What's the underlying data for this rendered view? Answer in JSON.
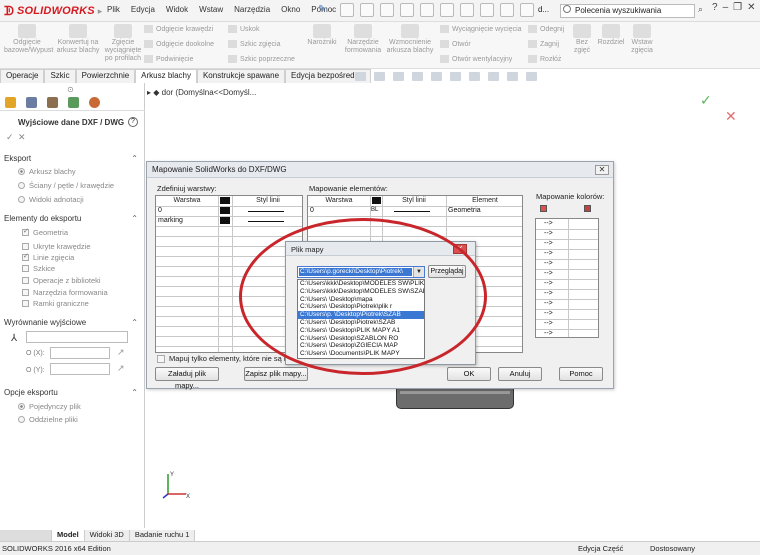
{
  "app": {
    "brand": "SOLIDWORKS",
    "menu": [
      "Plik",
      "Edycja",
      "Widok",
      "Wstaw",
      "Narzędzia",
      "Okno",
      "Pomoc"
    ],
    "doc_name": "d...",
    "search_placeholder": "Polecenia wyszukiwania"
  },
  "ribbon": {
    "big_buttons": [
      "Odgięcie bazowe/Wypust",
      "Konwertuj na arkusz blachy",
      "Zgięcie wyciągnięte po profilach"
    ],
    "small_col1": [
      "Odgięcie krawędzi",
      "Odgięcie dookolne",
      "Podwinięcie"
    ],
    "small_col2": [
      "Uskok",
      "Szkic zgięcia",
      "Szkic poprzeczne"
    ],
    "narozniki": "Narożniki",
    "middle_buttons": [
      "Narzędzie formowania",
      "Wzmocnienie arkusza blachy"
    ],
    "small_col3": [
      "Wyciągnięcie wycięcia",
      "Otwór",
      "Otwór wentylacyjny"
    ],
    "small_col4": [
      "Odegnij",
      "Zagnij",
      "Rozłóż"
    ],
    "right_buttons": [
      "Bez zgięć",
      "Rozdziel",
      "Wstaw zgięcia"
    ]
  },
  "tabs": [
    "Operacje",
    "Szkic",
    "Powierzchnie",
    "Arkusz blachy",
    "Konstrukcje spawane",
    "Edycja bezpośrednia"
  ],
  "active_tab": "Arkusz blachy",
  "tree_item": "dor  (Domyślna<<Domyśl...",
  "panel": {
    "title": "Wyjściowe dane DXF / DWG",
    "export_header": "Eksport",
    "export_options": [
      "Arkusz blachy",
      "Ściany / pętle / krawędzie",
      "Widoki adnotacji"
    ],
    "elements_header": "Elementy do eksportu",
    "elements": [
      {
        "label": "Geometria",
        "checked": true
      },
      {
        "label": "Ukryte krawędzie",
        "checked": false
      },
      {
        "label": "Linie zgięcia",
        "checked": true
      },
      {
        "label": "Szkice",
        "checked": false
      },
      {
        "label": "Operacje z biblioteki",
        "checked": false
      },
      {
        "label": "Narzędzia formowania",
        "checked": false
      },
      {
        "label": "Ramki graniczne",
        "checked": false
      }
    ],
    "align_header": "Wyrównanie wyjściowe",
    "ox": "O (X):",
    "oy": "O (Y):",
    "options_header": "Opcje eksportu",
    "options": [
      "Pojedynczy plik",
      "Oddzielne pliki"
    ]
  },
  "dialog": {
    "title": "Mapowanie SolidWorks do DXF/DWG",
    "define_layers": "Zdefiniuj warstwy:",
    "layers_cols": [
      "Warstwa",
      "Styl linii"
    ],
    "layers_rows": [
      "0",
      "marking"
    ],
    "mapping_label": "Mapowanie elementów:",
    "mapping_cols": [
      "Warstwa",
      "Styl linii",
      "Element"
    ],
    "mapping_row": {
      "layer": "0",
      "style_code": "BL",
      "element": "Geometria"
    },
    "color_mapping": "Mapowanie kolorów:",
    "arrow": "-->",
    "checkbox_label": "Mapuj tylko elementy, które nie są na warstwach SolidWorks",
    "buttons": [
      "Załaduj plik mapy...",
      "Zapisz plik mapy...",
      "OK",
      "Anuluj",
      "Pomoc"
    ]
  },
  "subdialog": {
    "title": "Plik mapy",
    "selected": "C:\\Users\\p.gorecki\\Desktop\\Piotrek\\",
    "browse": "Przeglądaj",
    "list": [
      "C:\\Users\\kkk\\Desktop\\MODELES SW\\PLIK",
      "C:\\Users\\kkk\\Desktop\\MODELES SW\\SZAB",
      "C:\\Users\\               \\Desktop\\mapa",
      "C:\\Users\\               \\Desktop\\Piotrek\\plik r",
      "C:\\Users\\p.              \\Desktop\\Piotrek\\SZAB",
      "C:\\Users\\               \\Desktop\\Piotrek\\SZAB",
      "C:\\Users\\               \\Desktop\\PLIK MAPY A1",
      "C:\\Users\\               \\Desktop\\SZABLON RO",
      "C:\\Users\\               \\Desktop\\ZGIECIA MAP",
      "C:\\Users\\               \\Documents\\PLIK MAPY"
    ],
    "highlight_index": 4
  },
  "bottom_tabs": [
    "Model",
    "Widoki 3D",
    "Badanie ruchu 1"
  ],
  "status": {
    "left": "SOLIDWORKS 2016 x64 Edition",
    "mode": "Edycja Część",
    "custom": "Dostosowany"
  },
  "colors": {
    "brand": "#d71920",
    "highlight": "#3a78d4",
    "annotation": "#c8262b"
  }
}
